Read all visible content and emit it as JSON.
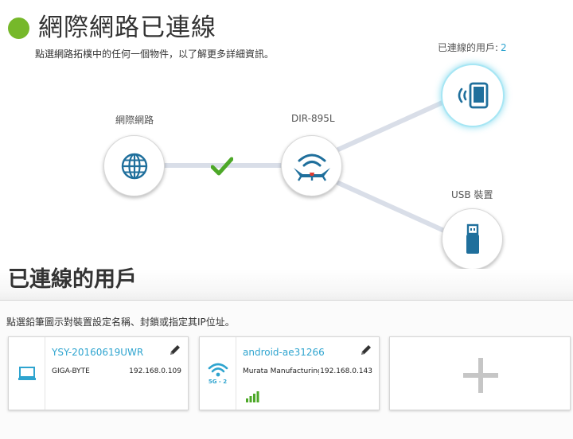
{
  "header": {
    "title": "網際網路已連線",
    "subtitle": "點選網路拓樸中的任何一個物件，以了解更多詳細資訊。",
    "status_color": "#76b82a"
  },
  "topology": {
    "internet_label": "網際網路",
    "router_label": "DIR-895L",
    "usb_label": "USB 裝置",
    "clients_label": "已連線的用戶:",
    "clients_count": "2",
    "accent_color": "#2ea4cf",
    "icons": {
      "internet": "globe-icon",
      "router": "router-icon",
      "clients": "wireless-tablet-icon",
      "usb": "usb-drive-icon",
      "link_status": "checkmark-icon"
    }
  },
  "clients_section": {
    "title": "已連線的用戶",
    "subtitle": "點選鉛筆圖示對裝置設定名稱、封鎖或指定其IP位址。",
    "clients": [
      {
        "name": "YSY-20160619UWR",
        "vendor": "GIGA-BYTE",
        "ip": "192.168.0.109",
        "icon": "laptop-icon"
      },
      {
        "name": "android-ae31266",
        "vendor": "Murata Manufacturing",
        "ip": "192.168.0.143",
        "icon": "wifi-icon",
        "band": "5G - 2"
      }
    ],
    "add_icon": "plus-icon"
  }
}
